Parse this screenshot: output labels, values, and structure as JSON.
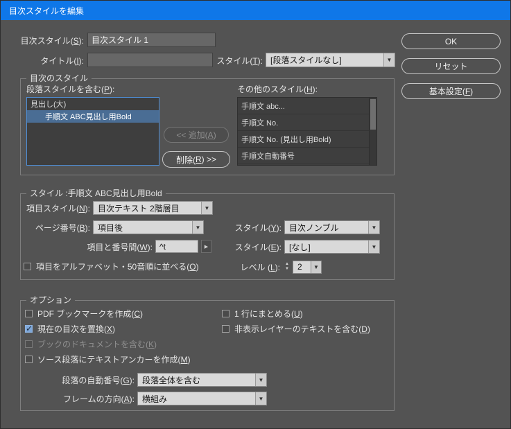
{
  "window": {
    "title": "目次スタイルを編集"
  },
  "colors": {
    "titlebar": "#0f77e8",
    "dialog_bg": "#535353",
    "selection": "#4a6d94",
    "focus_border": "#4f8ed6",
    "checkbox_checked": "#7fa8d9"
  },
  "header": {
    "toc_style_label": "目次スタイル(S):",
    "toc_style_value": "目次スタイル 1",
    "title_label": "タイトル(I):",
    "title_value": "",
    "title_style_label": "スタイル(T):",
    "title_style_value": "[段落スタイルなし]"
  },
  "buttons": {
    "ok": "OK",
    "reset": "リセット",
    "basic_settings": "基本設定(F)",
    "add": "<< 追加(A)",
    "remove": "削除(R) >>"
  },
  "toc_styles_group": {
    "legend": "目次のスタイル",
    "include_label": "段落スタイルを含む(P):",
    "include_items": [
      {
        "text": "見出し(大)",
        "selected": false
      },
      {
        "text": "手順文 ABC見出し用Bold",
        "selected": true
      }
    ],
    "other_label": "その他のスタイル(H):",
    "other_items": [
      {
        "text": "手順文 abc..."
      },
      {
        "text": "手順文 No."
      },
      {
        "text": "手順文 No. (見出し用Bold)"
      },
      {
        "text": "手順文自動番号"
      }
    ]
  },
  "style_group": {
    "legend": "スタイル :手順文 ABC見出し用Bold",
    "entry_style_label": "項目スタイル(N):",
    "entry_style_value": "目次テキスト 2階層目",
    "page_number_label": "ページ番号(B):",
    "page_number_value": "項目後",
    "page_style_label": "スタイル(Y):",
    "page_style_value": "目次ノンブル",
    "separator_label": "項目と番号間(W):",
    "separator_value": "^t",
    "separator_style_label": "スタイル(E):",
    "separator_style_value": "[なし]",
    "sort_checkbox": {
      "label": "項目をアルファベット・50音順に並べる(O)",
      "checked": false
    },
    "level_label": "レベル (L):",
    "level_value": "2"
  },
  "options_group": {
    "legend": "オプション",
    "checkboxes": [
      {
        "label": "PDF ブックマークを作成(C)",
        "checked": false,
        "disabled": false
      },
      {
        "label": "1 行にまとめる(U)",
        "checked": false,
        "disabled": false
      },
      {
        "label": "現在の目次を置換(X)",
        "checked": true,
        "disabled": false
      },
      {
        "label": "非表示レイヤーのテキストを含む(D)",
        "checked": false,
        "disabled": false
      },
      {
        "label": "ブックのドキュメントを含む(K)",
        "checked": false,
        "disabled": true
      },
      {
        "label": "ソース段落にテキストアンカーを作成(M)",
        "checked": false,
        "disabled": false
      }
    ],
    "numbered_paragraphs_label": "段落の自動番号(G):",
    "numbered_paragraphs_value": "段落全体を含む",
    "frame_direction_label": "フレームの方向(A):",
    "frame_direction_value": "横組み"
  }
}
